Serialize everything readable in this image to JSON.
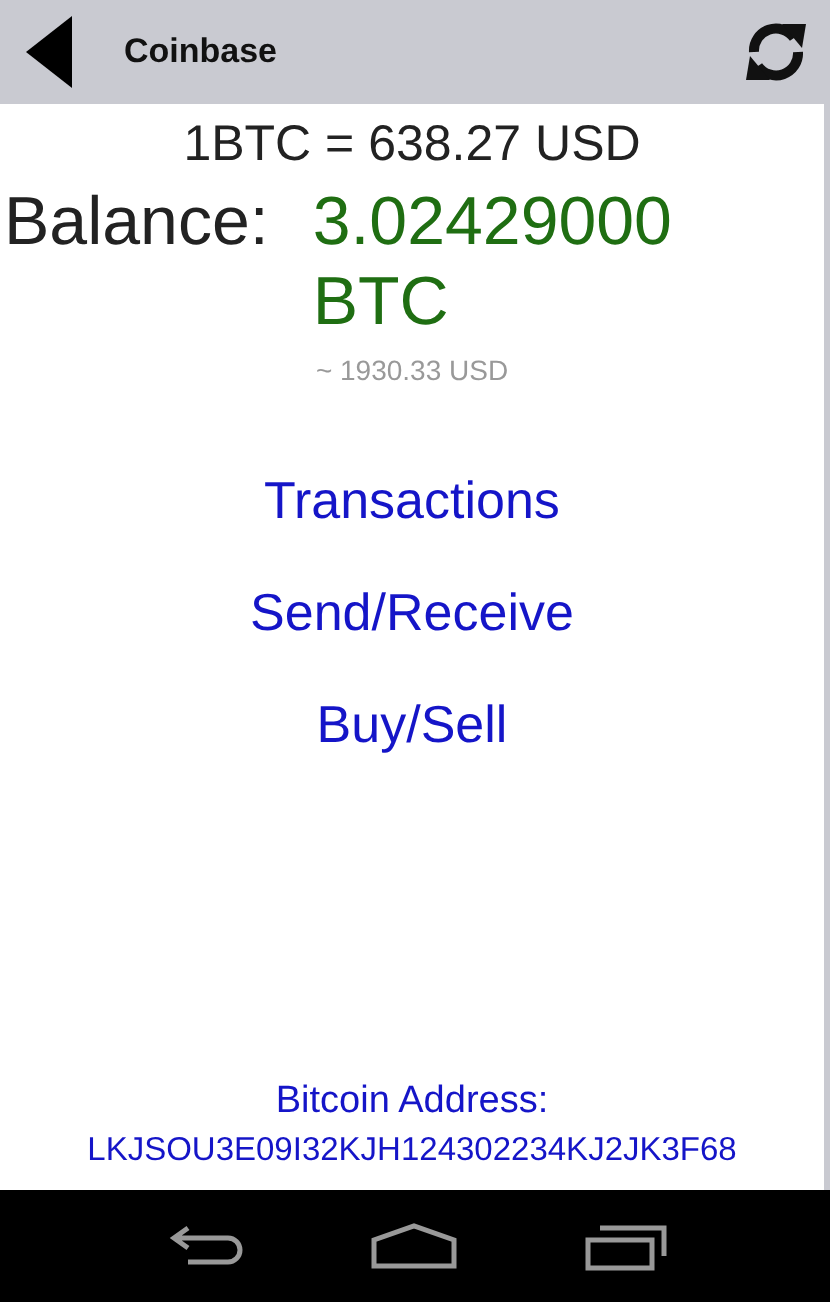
{
  "header": {
    "title": "Coinbase"
  },
  "rate": "1BTC = 638.27 USD",
  "balance": {
    "label": "Balance:",
    "value": "3.02429000 BTC",
    "usd": "~ 1930.33 USD"
  },
  "menu": [
    "Transactions",
    "Send/Receive",
    "Buy/Sell"
  ],
  "address": {
    "label": "Bitcoin Address:",
    "value": "LKJSOU3E09I32KJH124302234KJ2JK3F68"
  }
}
